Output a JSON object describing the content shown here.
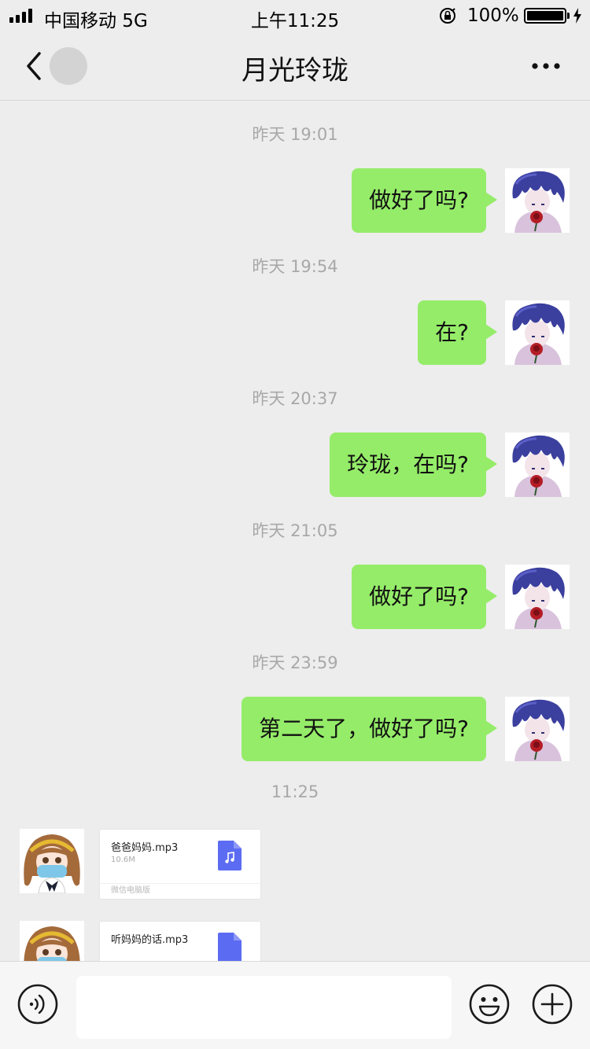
{
  "status_bar": {
    "carrier": "中国移动  5G",
    "time": "上午11:25",
    "battery_percent": "100%"
  },
  "navbar": {
    "title": "月光玲珑"
  },
  "messages": [
    {
      "timestamp": "昨天 19:01",
      "text": "做好了吗?"
    },
    {
      "timestamp": "昨天 19:54",
      "text": "在?"
    },
    {
      "timestamp": "昨天 20:37",
      "text": "玲珑，在吗?"
    },
    {
      "timestamp": "昨天 21:05",
      "text": "做好了吗?"
    },
    {
      "timestamp": "昨天 23:59",
      "text": "第二天了，做好了吗?"
    }
  ],
  "incoming": {
    "timestamp": "11:25",
    "files": [
      {
        "name": "爸爸妈妈.mp3",
        "size": "10.6M",
        "source": "微信电脑版"
      },
      {
        "name": "听妈妈的话.mp3"
      }
    ]
  },
  "colors": {
    "bubble": "#95ec69",
    "background": "#ededed",
    "file_icon": "#5b6cf2"
  },
  "icons": {
    "back": "chevron-left-icon",
    "more": "more-dots-icon",
    "voice": "voice-icon",
    "emoji": "emoji-icon",
    "plus": "plus-icon",
    "file": "music-file-icon"
  }
}
